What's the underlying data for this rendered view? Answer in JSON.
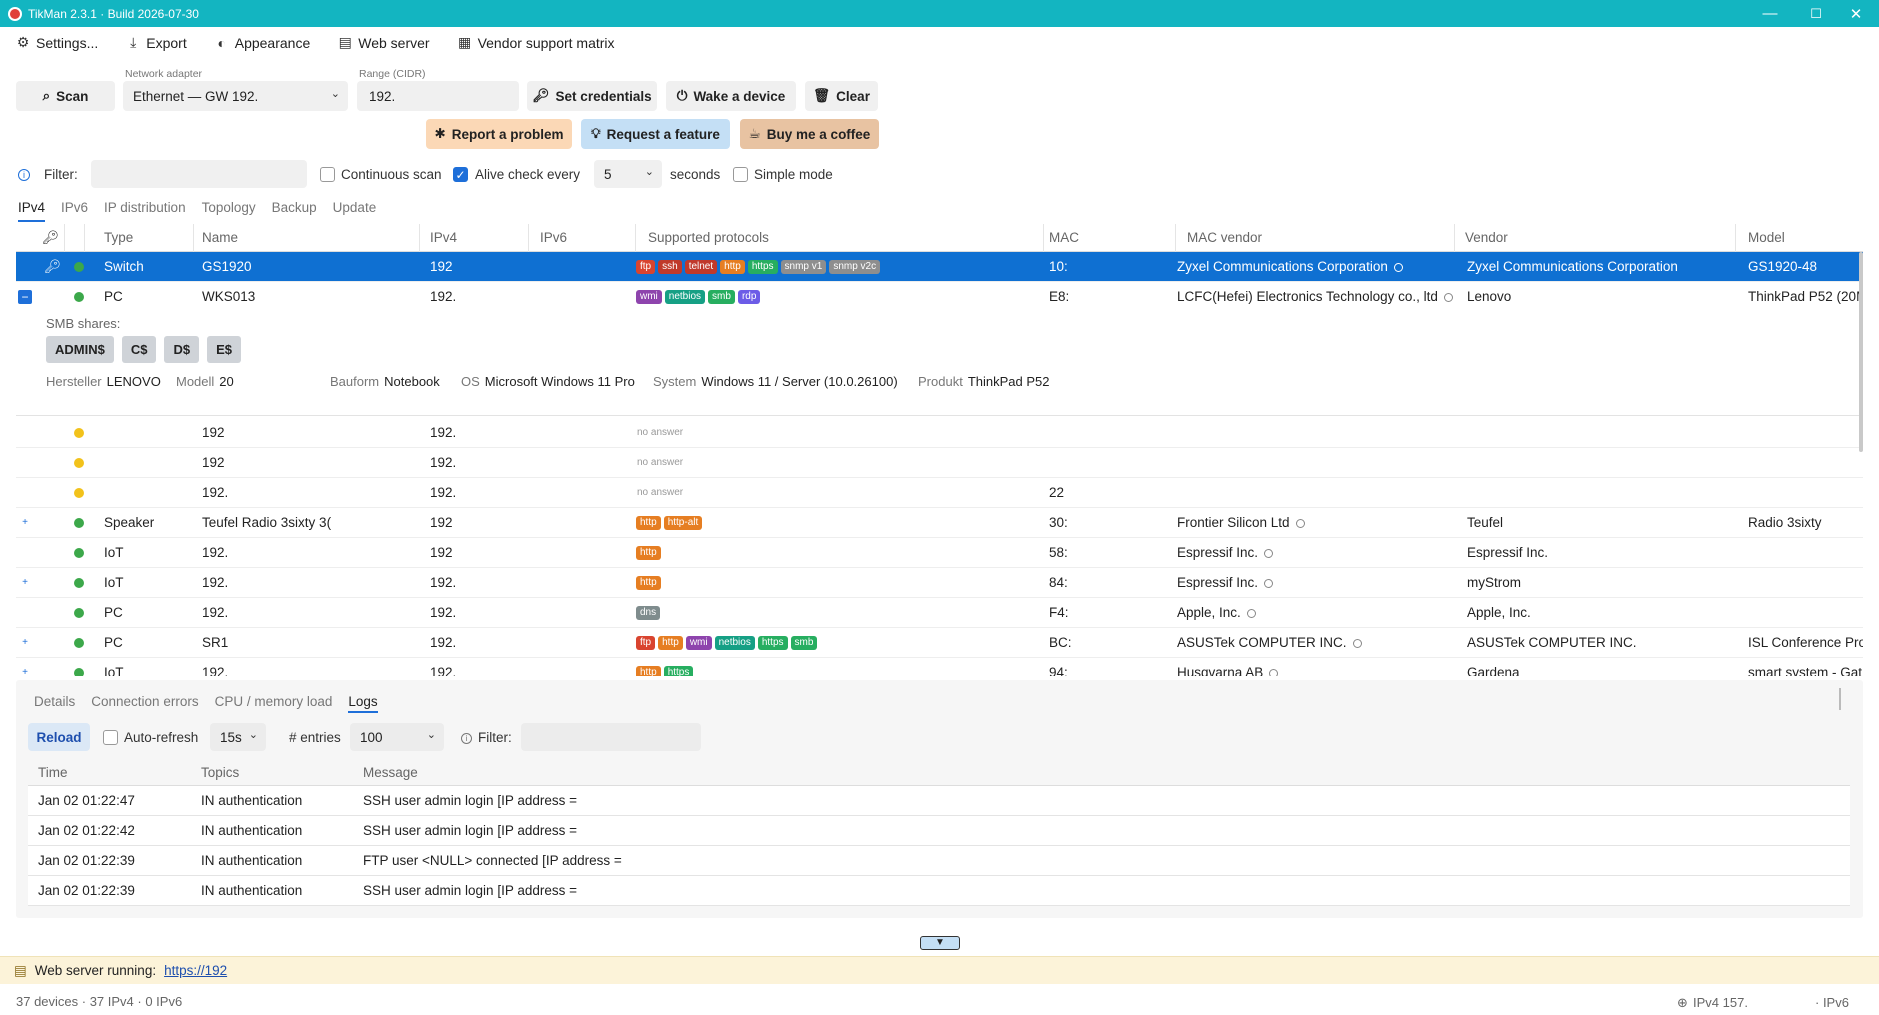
{
  "window": {
    "title": "TikMan 2.3.1 · Build 2026-07-30",
    "minimize": "—",
    "maximize": "☐",
    "close": "✕"
  },
  "menu": {
    "settings": "Settings...",
    "export": "Export",
    "appearance": "Appearance",
    "webserver": "Web server",
    "vendor_matrix": "Vendor support matrix"
  },
  "toolbar": {
    "scan": "Scan",
    "adapter_label": "Network adapter",
    "adapter_value": "Ethernet — GW 192.",
    "range_label": "Range (CIDR)",
    "range_value": "192.",
    "set_credentials": "Set credentials",
    "wake_device": "Wake a device",
    "clear": "Clear",
    "report_problem": "Report a problem",
    "request_feature": "Request a feature",
    "buy_coffee": "Buy me a coffee"
  },
  "filter": {
    "label": "Filter:",
    "value": "",
    "continuous_scan": "Continuous scan",
    "continuous_checked": false,
    "alive_check": "Alive check every",
    "alive_checked": true,
    "interval": "5",
    "seconds": "seconds",
    "simple_mode": "Simple mode",
    "simple_checked": false
  },
  "tabs": [
    "IPv4",
    "IPv6",
    "IP distribution",
    "Topology",
    "Backup",
    "Update"
  ],
  "columns": [
    "Type",
    "Name",
    "IPv4",
    "IPv6",
    "Supported protocols",
    "MAC",
    "MAC vendor",
    "Vendor",
    "Model"
  ],
  "tag_colors": {
    "ftp": "#d9442f",
    "ssh": "#c0392b",
    "telnet": "#c0392b",
    "http": "#e67e22",
    "https": "#27ae60",
    "snmp v1": "#8e8e8e",
    "snmp v2c": "#8e8e8e",
    "wmi": "#8e44ad",
    "netbios": "#16a085",
    "smb": "#27ae60",
    "rdp": "#6c5ce7",
    "http-alt": "#e67e22",
    "dns": "#7f8c8d"
  },
  "rows": [
    {
      "type": "Switch",
      "name": "GS1920",
      "ipv4": "192",
      "tags": [
        "ftp",
        "ssh",
        "telnet",
        "http",
        "https",
        "snmp v1",
        "snmp v2c"
      ],
      "mac": "10:",
      "mac_vendor": "Zyxel Communications Corporation",
      "vendor": "Zyxel Communications Corporation",
      "model": "GS1920-48"
    },
    {
      "type": "PC",
      "name": "WKS013",
      "ipv4": "192.",
      "tags": [
        "wmi",
        "netbios",
        "smb",
        "rdp"
      ],
      "mac": "E8:",
      "mac_vendor": "LCFC(Hefei) Electronics Technology co., ltd",
      "vendor": "Lenovo",
      "model": "ThinkPad P52 (20M"
    },
    {
      "type": "",
      "name": "192",
      "ipv4": "192.",
      "noanswer": "no answer",
      "mac": "",
      "mac_vendor": "",
      "vendor": "",
      "model": ""
    },
    {
      "type": "",
      "name": "192",
      "ipv4": "192.",
      "noanswer": "no answer",
      "mac": "",
      "mac_vendor": "",
      "vendor": "",
      "model": ""
    },
    {
      "type": "",
      "name": "192.",
      "ipv4": "192.",
      "noanswer": "no answer",
      "mac": "22",
      "mac_vendor": "",
      "vendor": "",
      "model": ""
    },
    {
      "type": "Speaker",
      "name": "Teufel Radio 3sixty 3(",
      "ipv4": "192",
      "tags": [
        "http",
        "http-alt"
      ],
      "mac": "30:",
      "mac_vendor": "Frontier Silicon Ltd",
      "vendor": "Teufel",
      "model": "Radio 3sixty"
    },
    {
      "type": "IoT",
      "name": "192.",
      "ipv4": "192",
      "tags": [
        "http"
      ],
      "mac": "58:",
      "mac_vendor": "Espressif Inc.",
      "vendor": "Espressif Inc.",
      "model": ""
    },
    {
      "type": "IoT",
      "name": "192.",
      "ipv4": "192.",
      "tags": [
        "http"
      ],
      "mac": "84:",
      "mac_vendor": "Espressif Inc.",
      "vendor": "myStrom",
      "model": ""
    },
    {
      "type": "PC",
      "name": "192.",
      "ipv4": "192.",
      "tags": [
        "dns"
      ],
      "mac": "F4:",
      "mac_vendor": "Apple, Inc.",
      "vendor": "Apple, Inc.",
      "model": ""
    },
    {
      "type": "PC",
      "name": "SR1",
      "ipv4": "192.",
      "tags": [
        "ftp",
        "http",
        "wmi",
        "netbios",
        "https",
        "smb"
      ],
      "mac": "BC:",
      "mac_vendor": "ASUSTek COMPUTER INC.",
      "vendor": "ASUSTek COMPUTER INC.",
      "model": "ISL Conference Pro"
    },
    {
      "type": "IoT",
      "name": "192.",
      "ipv4": "192.",
      "tags": [
        "http",
        "https"
      ],
      "mac": "94:",
      "mac_vendor": "Husqvarna AB",
      "vendor": "Gardena",
      "model": "smart system - Gat"
    }
  ],
  "details": {
    "smb_label": "SMB shares:",
    "shares": [
      "ADMIN$",
      "C$",
      "D$",
      "E$"
    ],
    "hersteller_k": "Hersteller",
    "hersteller_v": "LENOVO",
    "modell_k": "Modell",
    "modell_v": "20",
    "bauform_k": "Bauform",
    "bauform_v": "Notebook",
    "os_k": "OS",
    "os_v": "Microsoft Windows 11 Pro",
    "system_k": "System",
    "system_v": "Windows 11 / Server (10.0.26100)",
    "produkt_k": "Produkt",
    "produkt_v": "ThinkPad P52"
  },
  "panel": {
    "tabs": [
      "Details",
      "Connection errors",
      "CPU / memory load",
      "Logs"
    ],
    "reload": "Reload",
    "autorefresh": "Auto-refresh",
    "refresh_interval": "15s",
    "entries_label": "# entries",
    "entries_value": "100",
    "filter_label": "Filter:",
    "columns": [
      "Time",
      "Topics",
      "Message"
    ],
    "logs": [
      {
        "time": "Jan 02 01:22:47",
        "topic": "IN authentication",
        "message": "SSH user admin login [IP address ="
      },
      {
        "time": "Jan 02 01:22:42",
        "topic": "IN authentication",
        "message": "SSH user admin login [IP address ="
      },
      {
        "time": "Jan 02 01:22:39",
        "topic": "IN authentication",
        "message": "FTP user <NULL> connected [IP address ="
      },
      {
        "time": "Jan 02 01:22:39",
        "topic": "IN authentication",
        "message": "SSH user admin login [IP address ="
      }
    ]
  },
  "webserver": {
    "label": "Web server running:",
    "url": "https://192"
  },
  "status": {
    "summary": "37 devices · 37 IPv4 · 0 IPv6",
    "ipv4": "IPv4 157.",
    "ipv6": "· IPv6"
  }
}
